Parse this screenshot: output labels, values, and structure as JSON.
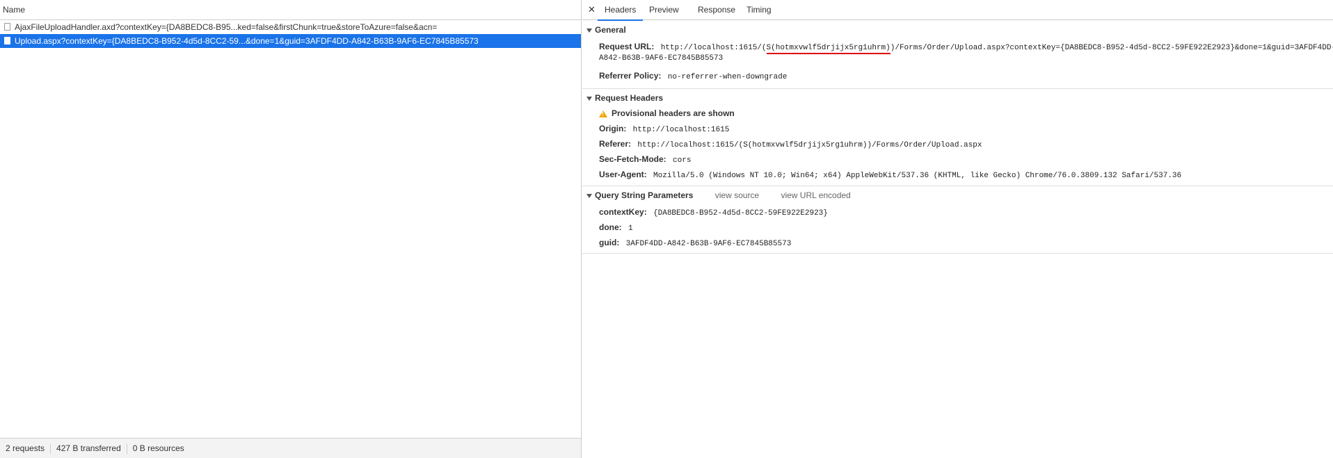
{
  "left": {
    "name_header": "Name",
    "requests": [
      {
        "label": "AjaxFileUploadHandler.axd?contextKey={DA8BEDC8-B95...ked=false&firstChunk=true&storeToAzure=false&acn="
      },
      {
        "label": "Upload.aspx?contextKey={DA8BEDC8-B952-4d5d-8CC2-59...&done=1&guid=3AFDF4DD-A842-B63B-9AF6-EC7845B85573"
      }
    ],
    "status": {
      "requests": "2 requests",
      "transferred": "427 B transferred",
      "resources": "0 B resources"
    }
  },
  "right": {
    "tabs": [
      "Headers",
      "Preview",
      "Response",
      "Timing"
    ],
    "active_tab": "Headers",
    "general": {
      "title": "General",
      "request_url_key": "Request URL:",
      "request_url_pre": "http://localhost:1615/(",
      "request_url_marked": "S(hotmxvwlf5drjijx5rg1uhrm)",
      "request_url_post": ")/Forms/Order/Upload.aspx?contextKey={DA8BEDC8-B952-4d5d-8CC2-59FE922E2923}&done=1&guid=3AFDF4DD-",
      "request_url_line2": "A842-B63B-9AF6-EC7845B85573",
      "referrer_policy_key": "Referrer Policy:",
      "referrer_policy_val": "no-referrer-when-downgrade"
    },
    "request_headers": {
      "title": "Request Headers",
      "warning": "Provisional headers are shown",
      "origin_key": "Origin:",
      "origin_val": "http://localhost:1615",
      "referer_key": "Referer:",
      "referer_val": "http://localhost:1615/(S(hotmxvwlf5drjijx5rg1uhrm))/Forms/Order/Upload.aspx",
      "sec_fetch_key": "Sec-Fetch-Mode:",
      "sec_fetch_val": "cors",
      "user_agent_key": "User-Agent:",
      "user_agent_val": "Mozilla/5.0 (Windows NT 10.0; Win64; x64) AppleWebKit/537.36 (KHTML, like Gecko) Chrome/76.0.3809.132 Safari/537.36"
    },
    "query_params": {
      "title": "Query String Parameters",
      "view_source": "view source",
      "view_url_encoded": "view URL encoded",
      "params": [
        {
          "key": "contextKey:",
          "val": "{DA8BEDC8-B952-4d5d-8CC2-59FE922E2923}"
        },
        {
          "key": "done:",
          "val": "1"
        },
        {
          "key": "guid:",
          "val": "3AFDF4DD-A842-B63B-9AF6-EC7845B85573"
        }
      ]
    }
  },
  "colors": {
    "selected_row": "#1a73e8",
    "annotation_underline": "#e00000",
    "warning": "#f2a600"
  }
}
